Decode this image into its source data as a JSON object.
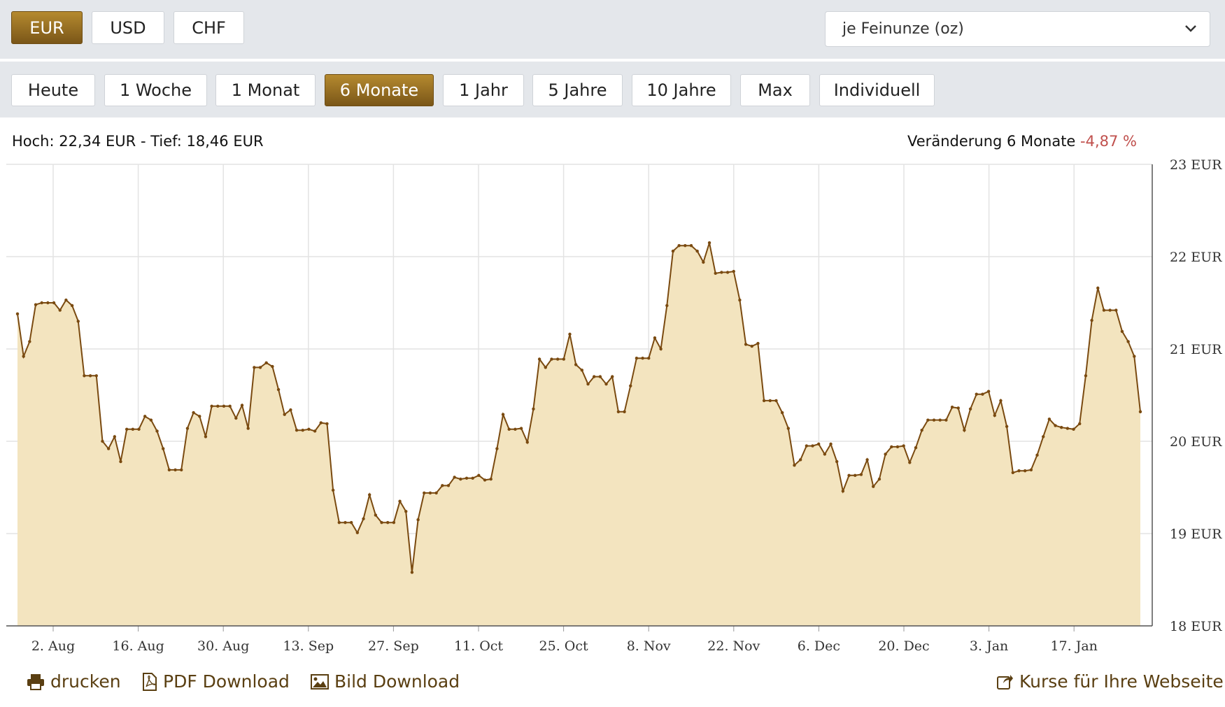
{
  "currency_tabs": [
    {
      "label": "EUR",
      "active": true
    },
    {
      "label": "USD",
      "active": false
    },
    {
      "label": "CHF",
      "active": false
    }
  ],
  "unit_select": {
    "value": "je Feinunze (oz)"
  },
  "period_tabs": [
    {
      "label": "Heute",
      "active": false
    },
    {
      "label": "1 Woche",
      "active": false
    },
    {
      "label": "1 Monat",
      "active": false
    },
    {
      "label": "6 Monate",
      "active": true
    },
    {
      "label": "1 Jahr",
      "active": false
    },
    {
      "label": "5 Jahre",
      "active": false
    },
    {
      "label": "10 Jahre",
      "active": false
    },
    {
      "label": "Max",
      "active": false
    },
    {
      "label": "Individuell",
      "active": false
    }
  ],
  "stats": {
    "high_low": "Hoch: 22,34 EUR - Tief: 18,46 EUR",
    "change_label": "Veränderung 6 Monate",
    "change_value": "-4,87 %"
  },
  "footer": {
    "print": "drucken",
    "pdf": "PDF Download",
    "image": "Bild Download",
    "embed": "Kurse für Ihre Webseite"
  },
  "colors": {
    "accent": "#8a6320",
    "line": "#7a4a10",
    "area": "#f3e4bf",
    "negative": "#c0504d"
  },
  "chart_data": {
    "type": "area",
    "x_tick_labels": [
      "2. Aug",
      "16. Aug",
      "30. Aug",
      "13. Sep",
      "27. Sep",
      "11. Oct",
      "25. Oct",
      "8. Nov",
      "22. Nov",
      "6. Dec",
      "20. Dec",
      "3. Jan",
      "17. Jan"
    ],
    "y_tick_labels": [
      "18 EUR",
      "19 EUR",
      "20 EUR",
      "21 EUR",
      "22 EUR",
      "23 EUR"
    ],
    "ylim": [
      18,
      23
    ],
    "grid": true,
    "values": [
      21.38,
      20.92,
      21.08,
      21.48,
      21.5,
      21.5,
      21.5,
      21.42,
      21.53,
      21.47,
      21.3,
      20.71,
      20.71,
      20.71,
      20.0,
      19.92,
      20.05,
      19.78,
      20.13,
      20.13,
      20.13,
      20.27,
      20.23,
      20.11,
      19.92,
      19.69,
      19.69,
      19.69,
      20.14,
      20.31,
      20.27,
      20.05,
      20.38,
      20.38,
      20.38,
      20.38,
      20.25,
      20.39,
      20.14,
      20.8,
      20.8,
      20.85,
      20.81,
      20.56,
      20.29,
      20.34,
      20.12,
      20.12,
      20.13,
      20.11,
      20.2,
      20.19,
      19.47,
      19.12,
      19.12,
      19.12,
      19.01,
      19.16,
      19.42,
      19.2,
      19.12,
      19.12,
      19.12,
      19.35,
      19.24,
      18.58,
      19.15,
      19.44,
      19.44,
      19.44,
      19.52,
      19.52,
      19.61,
      19.59,
      19.6,
      19.6,
      19.63,
      19.58,
      19.59,
      19.92,
      20.29,
      20.13,
      20.13,
      20.14,
      19.99,
      20.35,
      20.89,
      20.8,
      20.89,
      20.89,
      20.89,
      21.16,
      20.83,
      20.77,
      20.62,
      20.7,
      20.7,
      20.62,
      20.7,
      20.32,
      20.32,
      20.6,
      20.9,
      20.9,
      20.9,
      21.12,
      21.0,
      21.47,
      22.06,
      22.12,
      22.12,
      22.12,
      22.06,
      21.94,
      22.15,
      21.82,
      21.83,
      21.83,
      21.84,
      21.53,
      21.05,
      21.03,
      21.06,
      20.44,
      20.44,
      20.44,
      20.31,
      20.14,
      19.74,
      19.8,
      19.95,
      19.95,
      19.97,
      19.86,
      19.97,
      19.78,
      19.46,
      19.63,
      19.63,
      19.64,
      19.8,
      19.51,
      19.59,
      19.86,
      19.94,
      19.94,
      19.95,
      19.77,
      19.93,
      20.12,
      20.23,
      20.23,
      20.23,
      20.23,
      20.37,
      20.36,
      20.12,
      20.35,
      20.51,
      20.51,
      20.54,
      20.28,
      20.44,
      20.16,
      19.66,
      19.68,
      19.68,
      19.69,
      19.85,
      20.05,
      20.24,
      20.17,
      20.15,
      20.14,
      20.13,
      20.19,
      20.71,
      21.31,
      21.66,
      21.42,
      21.42,
      21.42,
      21.19,
      21.08,
      20.92,
      20.32
    ]
  }
}
